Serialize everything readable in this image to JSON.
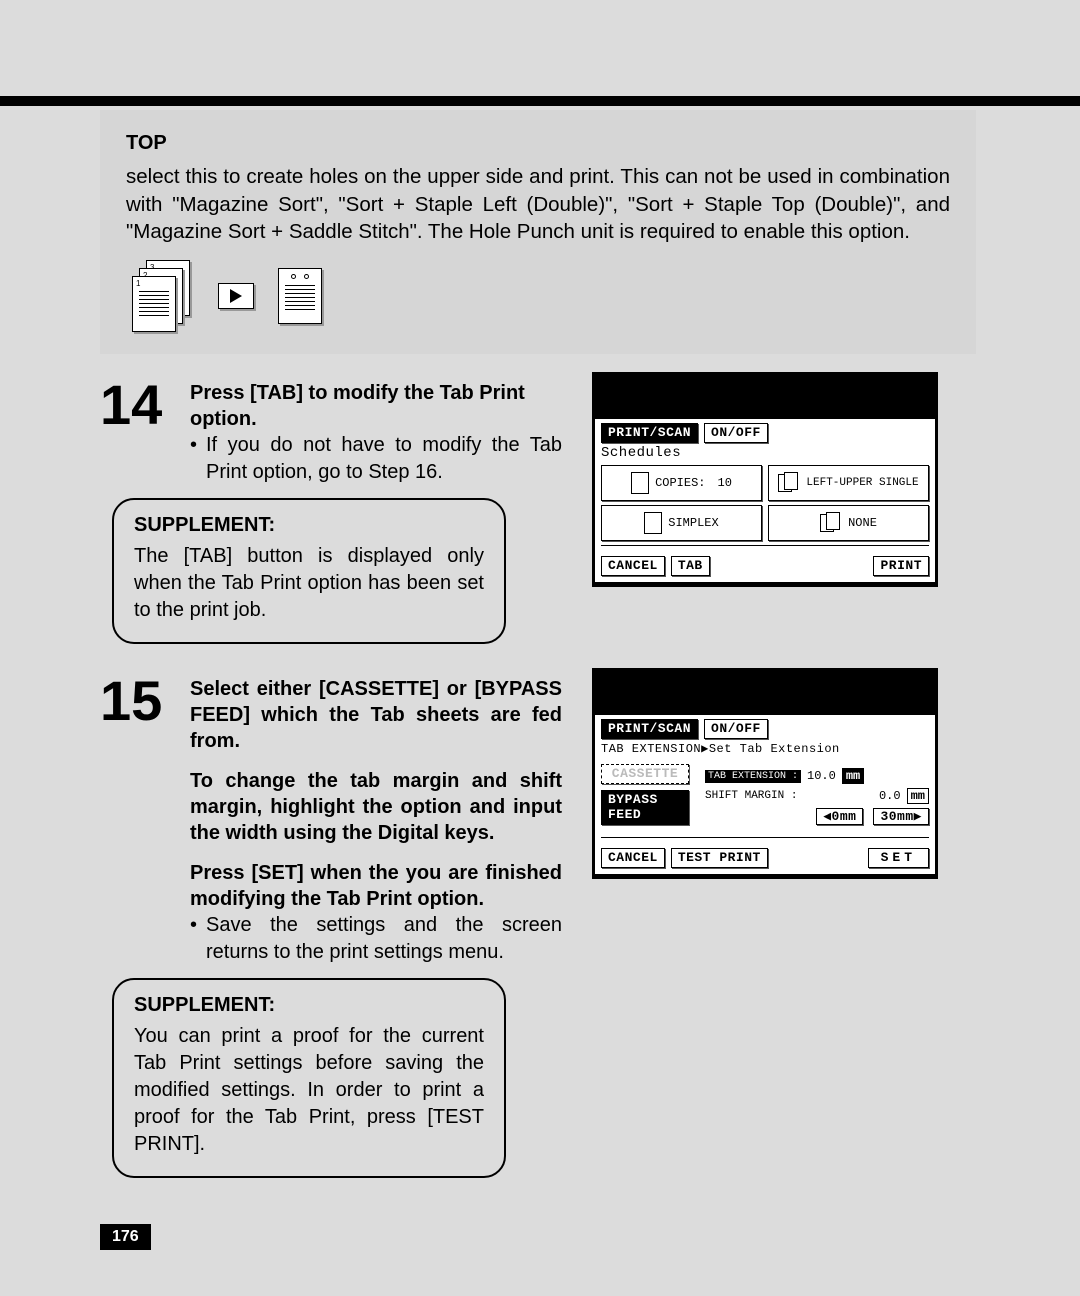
{
  "top_section": {
    "title": "TOP",
    "text": "select this to create holes on the upper side and print.  This can not be used in combination with \"Magazine Sort\", \"Sort + Staple Left (Double)\", \"Sort + Staple Top (Double)\", and \"Magazine Sort + Saddle Stitch\".  The Hole Punch unit is required to enable this option."
  },
  "step14": {
    "number": "14",
    "title": "Press [TAB] to modify the Tab Print option.",
    "bullet": "If you do not have to modify the Tab Print option, go to Step 16.",
    "supplement_title": "SUPPLEMENT:",
    "supplement_text": "The [TAB] button is displayed only when the Tab Print option has been set to the print job."
  },
  "step15": {
    "number": "15",
    "title": "Select either [CASSETTE] or [BYPASS FEED] which the Tab sheets are fed from.",
    "para1": "To change the tab margin and shift margin, highlight the option and input the width using the Digital keys.",
    "para2": "Press [SET] when the you are finished modifying the Tab Print option.",
    "bullet": "Save the settings and the screen returns to the print settings menu.",
    "supplement_title": "SUPPLEMENT:",
    "supplement_text": "You can print a proof for the current Tab Print settings before saving the modified settings.  In order to print a proof for the Tab Print, press [TEST PRINT]."
  },
  "lcd1": {
    "print_scan": "PRINT/SCAN",
    "onoff": "ON/OFF",
    "subtitle": "Schedules",
    "copies_label": "COPIES:",
    "copies_value": "10",
    "staple": "LEFT-UPPER SINGLE",
    "simplex": "SIMPLEX",
    "none": "NONE",
    "cancel": "CANCEL",
    "tab": "TAB",
    "print": "PRINT"
  },
  "lcd2": {
    "print_scan": "PRINT/SCAN",
    "onoff": "ON/OFF",
    "breadcrumb": "TAB EXTENSION▶Set Tab Extension",
    "cassette": "CASSETTE",
    "bypass": "BYPASS FEED",
    "tab_ext_label": "TAB EXTENSION :",
    "tab_ext_val": "10.0",
    "shift_label": "SHIFT MARGIN :",
    "shift_val": "0.0",
    "mm": "mm",
    "zero": "0mm",
    "thirty": "30mm",
    "cancel": "CANCEL",
    "test": "TEST PRINT",
    "set": "SET"
  },
  "page_number": "176"
}
